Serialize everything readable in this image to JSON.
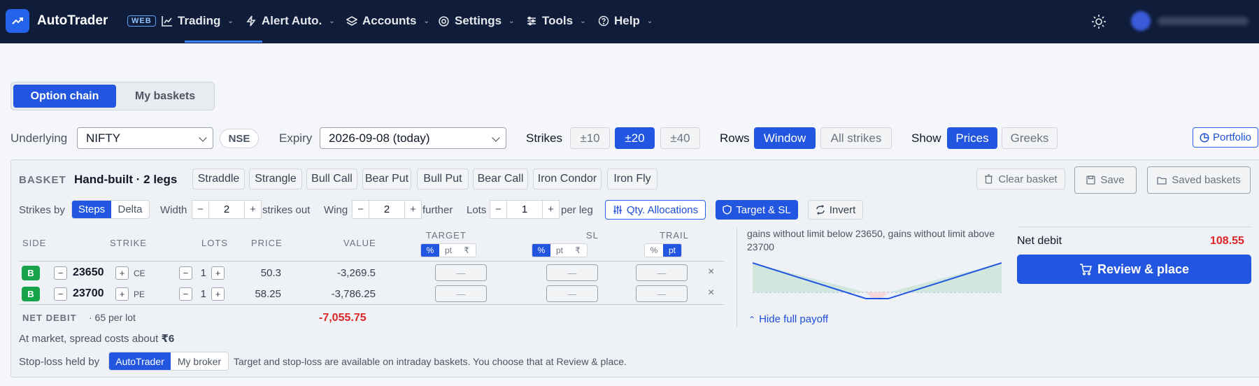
{
  "app": {
    "name": "AutoTrader",
    "tag": "WEB"
  },
  "nav": [
    {
      "label": "Trading",
      "icon": "chart-line-icon"
    },
    {
      "label": "Alert Auto.",
      "icon": "bolt-icon"
    },
    {
      "label": "Accounts",
      "icon": "layers-icon"
    },
    {
      "label": "Settings",
      "icon": "gear-icon"
    },
    {
      "label": "Tools",
      "icon": "sliders-icon"
    },
    {
      "label": "Help",
      "icon": "help-circle-icon"
    }
  ],
  "view_toggle": {
    "option_chain": "Option chain",
    "my_baskets": "My baskets",
    "selected": "Option chain"
  },
  "controls": {
    "underlying_label": "Underlying",
    "underlying_value": "NIFTY",
    "exchange": "NSE",
    "expiry_label": "Expiry",
    "expiry_value": "2026-09-08 (today)",
    "strikes_label": "Strikes",
    "strikes_options": [
      "±10",
      "±20",
      "±40"
    ],
    "strikes_selected": "±20",
    "rows_label": "Rows",
    "rows_options": [
      "Window",
      "All strikes"
    ],
    "rows_selected": "Window",
    "show_label": "Show",
    "show_options": [
      "Prices",
      "Greeks"
    ],
    "show_selected": "Prices",
    "portfolio": "Portfolio"
  },
  "basket": {
    "header": "BASKET",
    "name": "Hand-built · 2 legs",
    "strategies": [
      "Straddle",
      "Strangle",
      "Bull Call",
      "Bear Put",
      "Bull Put",
      "Bear Call",
      "Iron Condor",
      "Iron Fly"
    ],
    "clear": "Clear basket",
    "save": "Save",
    "saved": "Saved baskets",
    "strikes_by_label": "Strikes by",
    "strikes_by_options": [
      "Steps",
      "Delta"
    ],
    "strikes_by_selected": "Steps",
    "width_label": "Width",
    "width_value": "2",
    "width_suffix": "strikes out",
    "wing_label": "Wing",
    "wing_value": "2",
    "wing_suffix": "further",
    "lots_label": "Lots",
    "lots_value": "1",
    "lots_suffix": "per leg",
    "qty_alloc": "Qty. Allocations",
    "target_sl": "Target & SL",
    "invert": "Invert",
    "columns": {
      "side": "SIDE",
      "strike": "STRIKE",
      "lots": "LOTS",
      "price": "PRICE",
      "value": "VALUE",
      "target": "TARGET",
      "sl": "SL",
      "trail": "TRAIL"
    },
    "unit_options": [
      "%",
      "pt",
      "₹"
    ],
    "trail_unit_options": [
      "%",
      "pt"
    ],
    "legs": [
      {
        "side": "B",
        "strike": "23650",
        "type": "CE",
        "lots": "1",
        "price": "50.3",
        "value": "-3,269.5",
        "target": "—",
        "sl": "—",
        "trail": "—"
      },
      {
        "side": "B",
        "strike": "23700",
        "type": "PE",
        "lots": "1",
        "price": "58.25",
        "value": "-3,786.25",
        "target": "—",
        "sl": "—",
        "trail": "—"
      }
    ],
    "net_debit_label": "NET DEBIT",
    "net_debit_sub": "· 65 per lot",
    "net_debit_value": "-7,055.75",
    "spread_text": "At market, spread costs about",
    "spread_value": "₹6",
    "stoploss_label": "Stop-loss held by",
    "stoploss_options": [
      "AutoTrader",
      "My broker"
    ],
    "stoploss_selected": "AutoTrader",
    "stoploss_note": "Target and stop-loss are available on intraday baskets. You choose that at Review & place.",
    "payoff_text": "gains without limit below 23650, gains without limit above 23700",
    "hide_payoff": "Hide full payoff",
    "summary_net_label": "Net debit",
    "summary_net_value": "108.55",
    "review_button": "Review & place"
  }
}
